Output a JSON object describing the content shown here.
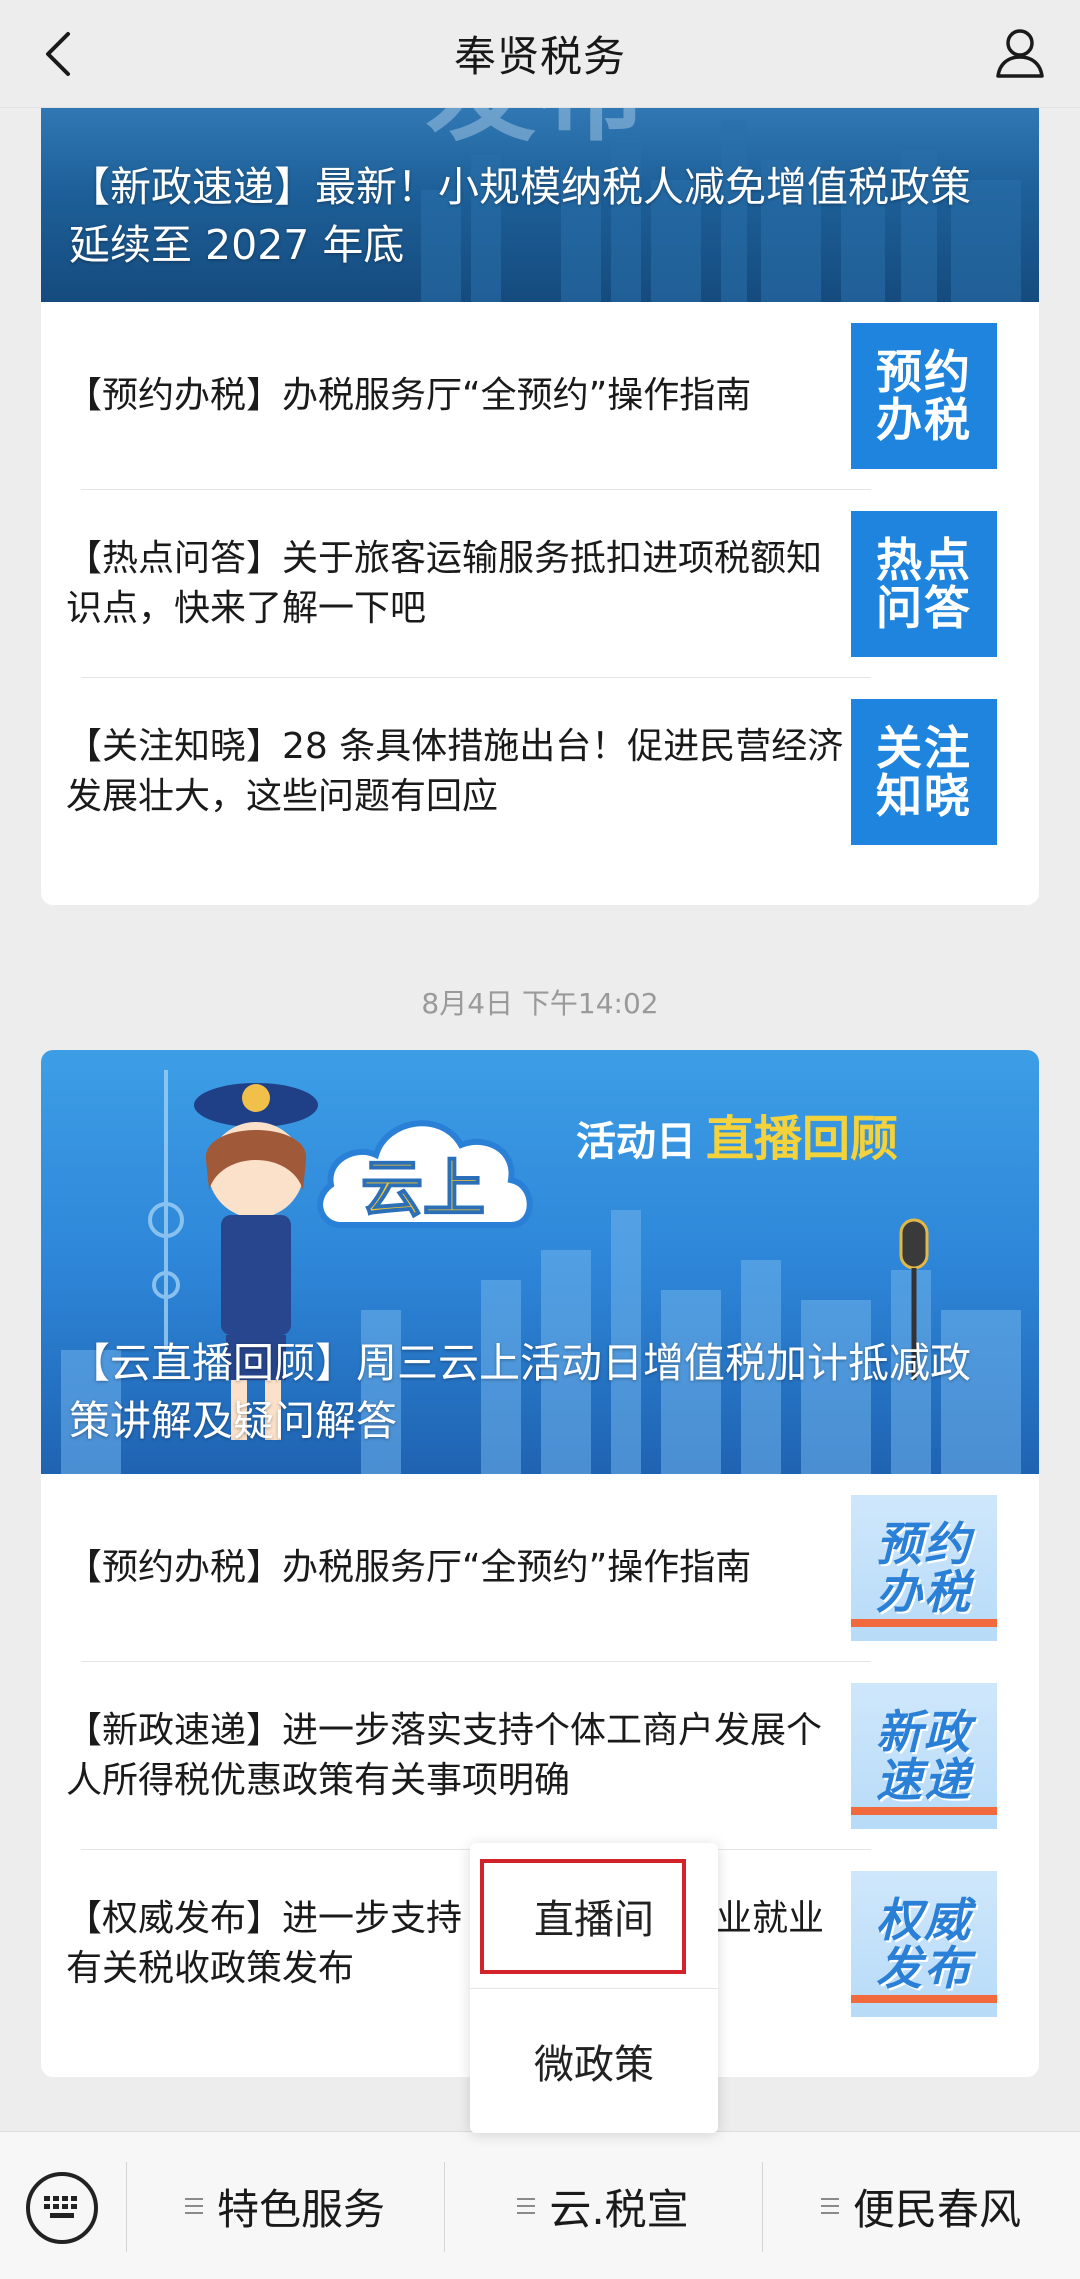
{
  "header": {
    "title": "奉贤税务",
    "back_icon": "chevron-left-icon",
    "user_icon": "user-icon"
  },
  "cards": [
    {
      "cover_title": "【新政速递】最新！小规模纳税人减免增值税政策延续至 2027 年底",
      "cover_overlay_text": "发布",
      "items": [
        {
          "title": "【预约办税】办税服务厅“全预约”操作指南",
          "thumb_line1": "预约",
          "thumb_line2": "办税"
        },
        {
          "title": "【热点问答】关于旅客运输服务抵扣进项税额知识点，快来了解一下吧",
          "thumb_line1": "热点",
          "thumb_line2": "问答"
        },
        {
          "title": "【关注知晓】28 条具体措施出台！促进民营经济发展壮大，这些问题有回应",
          "thumb_line1": "关注",
          "thumb_line2": "知晓"
        }
      ]
    },
    {
      "cover_title": "【云直播回顾】周三云上活动日增值税加计抵减政策讲解及疑问解答",
      "cover_banner_cloud": "云上",
      "cover_banner_prefix": "活动日",
      "cover_banner_highlight": "直播回顾",
      "items": [
        {
          "title": "【预约办税】办税服务厅“全预约”操作指南",
          "thumb_line1": "预约",
          "thumb_line2": "办税"
        },
        {
          "title": "【新政速递】进一步落实支持个体工商户发展个人所得税优惠政策有关事项明确",
          "thumb_line1": "新政",
          "thumb_line2": "速递"
        },
        {
          "title_before": "【权威发布】进一步支持",
          "title_after": "业就业",
          "title_line2": "有关税收政策发布",
          "thumb_line1": "权威",
          "thumb_line2": "发布"
        }
      ]
    }
  ],
  "timestamp": "8月4日 下午14:02",
  "popup_menu": {
    "items": [
      "直播间",
      "微政策"
    ],
    "highlighted_index": 0
  },
  "bottom_menu": {
    "keyboard_icon": "keyboard-icon",
    "items": [
      "特色服务",
      "云.税宣",
      "便民春风"
    ]
  },
  "colors": {
    "page_bg": "#ededed",
    "thumb_blue": "#1f84dd",
    "highlight_red": "#d3232a"
  }
}
